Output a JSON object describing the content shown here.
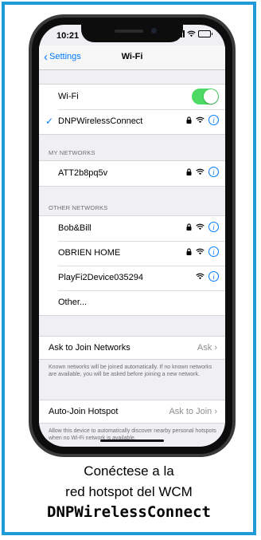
{
  "status_bar": {
    "time": "10:21"
  },
  "nav": {
    "back_label": "Settings",
    "title": "Wi-Fi"
  },
  "wifi": {
    "label": "Wi-Fi",
    "enabled": true
  },
  "connected_network": {
    "name": "DNPWirelessConnect"
  },
  "my_networks": {
    "header": "MY NETWORKS",
    "items": [
      {
        "name": "ATT2b8pq5v"
      }
    ]
  },
  "other_networks": {
    "header": "OTHER NETWORKS",
    "items": [
      {
        "name": "Bob&Bill",
        "secured": true
      },
      {
        "name": "OBRIEN HOME",
        "secured": true
      },
      {
        "name": "PlayFi2Device035294",
        "secured": false
      }
    ],
    "other_label": "Other..."
  },
  "ask_to_join": {
    "label": "Ask to Join Networks",
    "value": "Ask",
    "footnote": "Known networks will be joined automatically. If no known networks are available, you will be asked before joining a new network."
  },
  "auto_join": {
    "label": "Auto-Join Hotspot",
    "value": "Ask to Join",
    "footnote": "Allow this device to automatically discover nearby personal hotspots when no Wi-Fi network is available."
  },
  "caption": {
    "line1": "Conéctese a la",
    "line2": "red hotspot del WCM",
    "line3": "DNPWirelessConnect"
  },
  "colors": {
    "accent": "#007aff",
    "toggle_on": "#4cd964",
    "frame_border": "#1e9bd7"
  },
  "icons": [
    "lock-icon",
    "wifi-icon",
    "info-icon",
    "checkmark-icon",
    "chevron-left-icon",
    "chevron-right-icon"
  ]
}
